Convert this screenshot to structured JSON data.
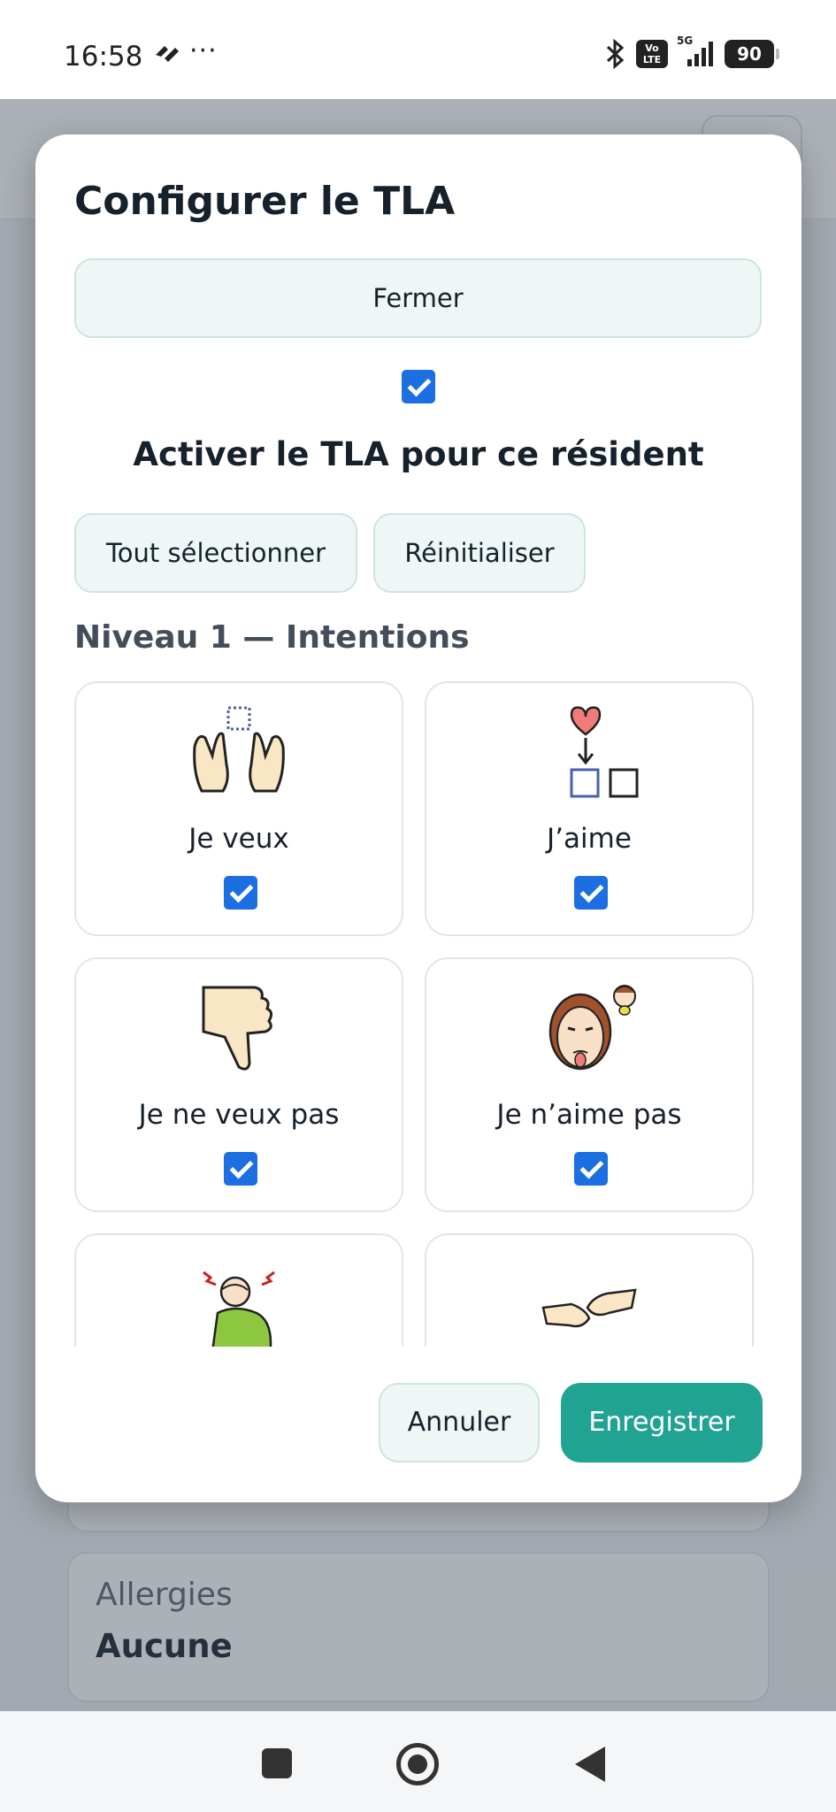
{
  "status_bar": {
    "time": "16:58",
    "dots": "···",
    "volte": "Vo LTE",
    "network": "5G",
    "battery": "90"
  },
  "background_page": {
    "allergies_label": "Allergies",
    "allergies_value": "Aucune"
  },
  "modal": {
    "title": "Configurer le TLA",
    "close_label": "Fermer",
    "enable_checked": true,
    "enable_label": "Activer le TLA pour ce résident",
    "select_all_label": "Tout sélectionner",
    "reset_label": "Réinitialiser",
    "section_title": "Niveau 1 — Intentions",
    "items": [
      {
        "label": "Je veux",
        "icon": "want-hands-icon",
        "checked": true
      },
      {
        "label": "J’aime",
        "icon": "like-heart-icon",
        "checked": true
      },
      {
        "label": "Je ne veux pas",
        "icon": "thumbs-down-icon",
        "checked": true
      },
      {
        "label": "Je n’aime pas",
        "icon": "dislike-face-icon",
        "checked": true
      },
      {
        "label": "",
        "icon": "headache-person-icon",
        "checked": true
      },
      {
        "label": "",
        "icon": "handshake-icon",
        "checked": true
      }
    ],
    "cancel_label": "Annuler",
    "save_label": "Enregistrer"
  },
  "colors": {
    "primary": "#21a394",
    "checkbox": "#1b6fe0",
    "button_bg": "#eef7f6"
  }
}
